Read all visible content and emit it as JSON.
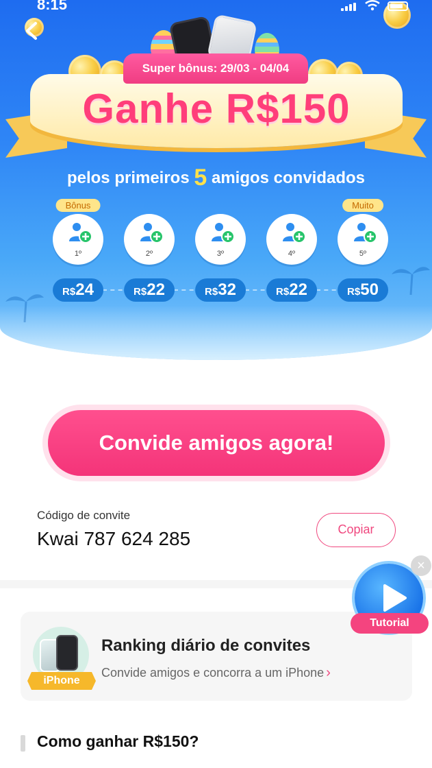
{
  "status_bar": {
    "time": "8:15"
  },
  "hero": {
    "promo_pill": "Super bônus: 29/03 - 04/04",
    "headline": "Ganhe R$150",
    "subhead_prefix": "pelos primeiros",
    "subhead_number": "5",
    "subhead_suffix": "amigos convidados",
    "tiers": [
      {
        "tag": "Bônus",
        "order": "1º",
        "currency": "R$",
        "amount": "24"
      },
      {
        "tag": "",
        "order": "2º",
        "currency": "R$",
        "amount": "22"
      },
      {
        "tag": "",
        "order": "3º",
        "currency": "R$",
        "amount": "32"
      },
      {
        "tag": "",
        "order": "4º",
        "currency": "R$",
        "amount": "22"
      },
      {
        "tag": "Muito",
        "order": "5º",
        "currency": "R$",
        "amount": "50"
      }
    ]
  },
  "cta": {
    "label": "Convide amigos agora!"
  },
  "invite": {
    "label": "Código de convite",
    "code": "Kwai 787 624 285",
    "copy_label": "Copiar"
  },
  "tutorial": {
    "label": "Tutorial",
    "close": "×"
  },
  "ranking": {
    "title": "Ranking diário de convites",
    "subtitle": "Convide amigos e concorra a um iPhone",
    "chevron": "›",
    "thumb_label": "iPhone"
  },
  "howto": {
    "title": "Como ganhar R$150?"
  },
  "colors": {
    "brand_pink": "#f43479",
    "hero_blue": "#2f86f6",
    "amount_pill": "#1a7bd6",
    "accent_yellow": "#ffe14a"
  },
  "icons": [
    "back-arrow-icon",
    "signal-icon",
    "wifi-icon",
    "battery-icon",
    "add-friend-icon",
    "play-icon",
    "close-icon",
    "chevron-right-icon"
  ]
}
